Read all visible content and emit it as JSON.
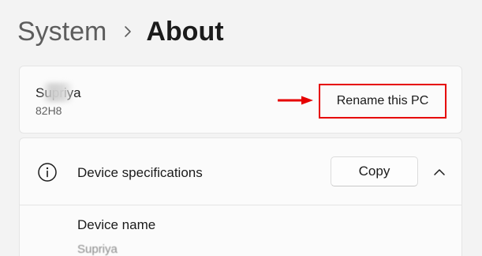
{
  "breadcrumb": {
    "parent": "System",
    "current": "About"
  },
  "pc": {
    "name": "Supriya",
    "model": "82H8",
    "rename_label": "Rename this PC"
  },
  "specs": {
    "title": "Device specifications",
    "copy_label": "Copy",
    "device_name_label": "Device name",
    "device_name_value": "Supriya"
  },
  "colors": {
    "annotation_red": "#e60000",
    "background": "#f3f3f3",
    "card": "#fbfbfb"
  },
  "icons": {
    "breadcrumb_separator": "chevron-right-icon",
    "specs_icon": "info-icon",
    "collapse": "chevron-up-icon",
    "annotation": "red-arrow-icon"
  }
}
